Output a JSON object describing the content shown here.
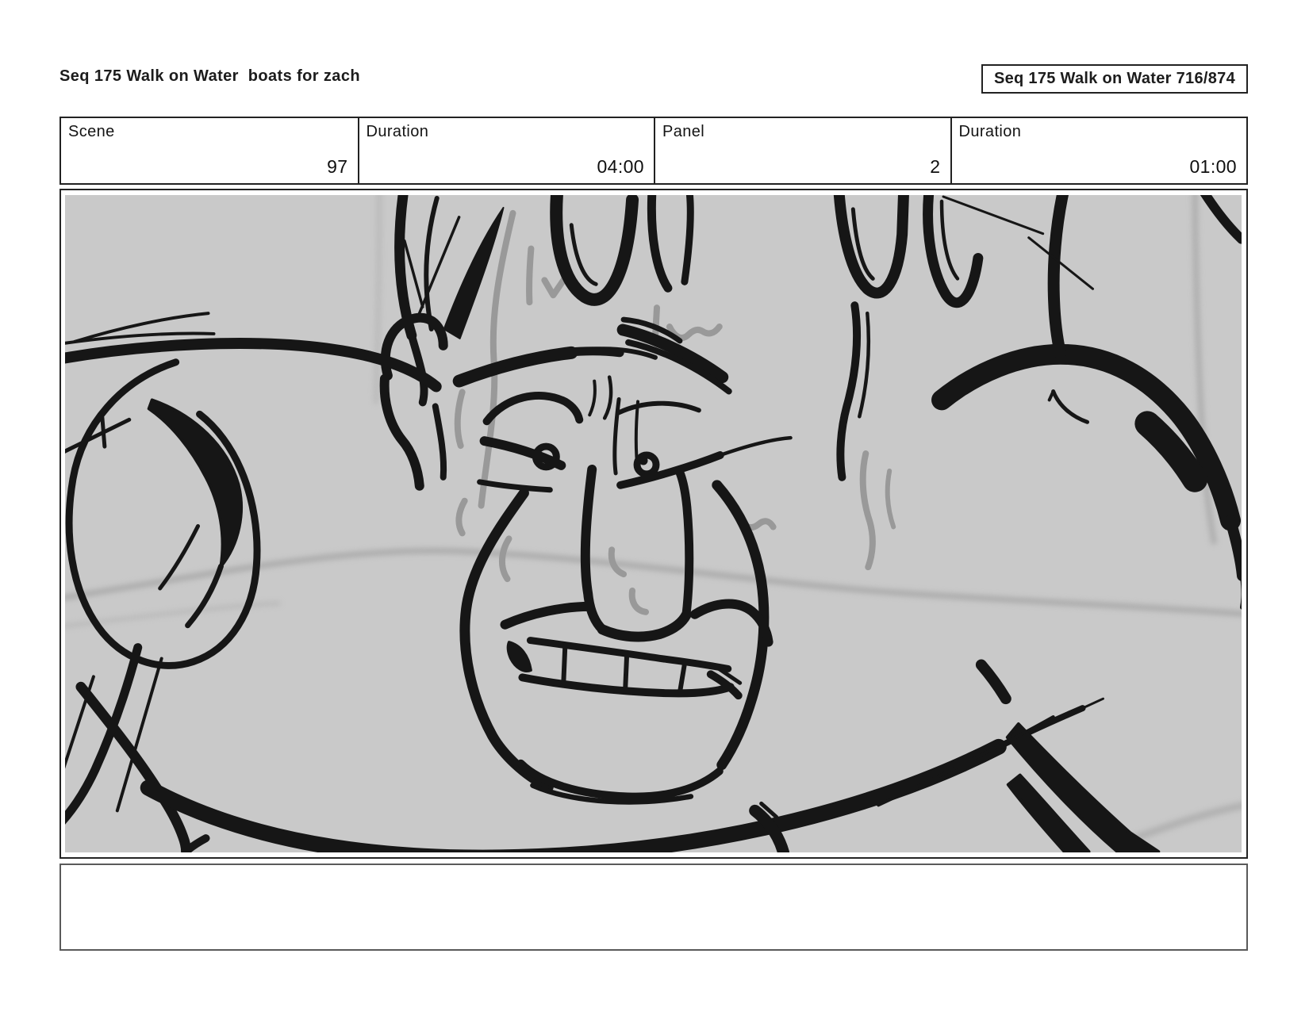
{
  "header": {
    "title_left": "Seq 175 Walk on Water  boats for zach",
    "title_right": "Seq 175 Walk on Water 716/874"
  },
  "metadata_table": {
    "cells": [
      {
        "label": "Scene",
        "value": "97"
      },
      {
        "label": "Duration",
        "value": "04:00"
      },
      {
        "label": "Panel",
        "value": "2"
      },
      {
        "label": "Duration",
        "value": "01:00"
      }
    ]
  },
  "storyboard_panel": {
    "drawing_description": "Rough black brush-ink storyboard sketch of a man grimacing with gritted teeth and furrowed brows, head lowered between raised shoulders; loose circular shoulder scribble at left, thick sweeping chest stroke below, soft blurred gray guide lines across the background",
    "canvas_color": "#c9c9c9",
    "ink_color": "#161616",
    "accent_ink_color": "#999999"
  },
  "notes_box": {
    "text": ""
  }
}
